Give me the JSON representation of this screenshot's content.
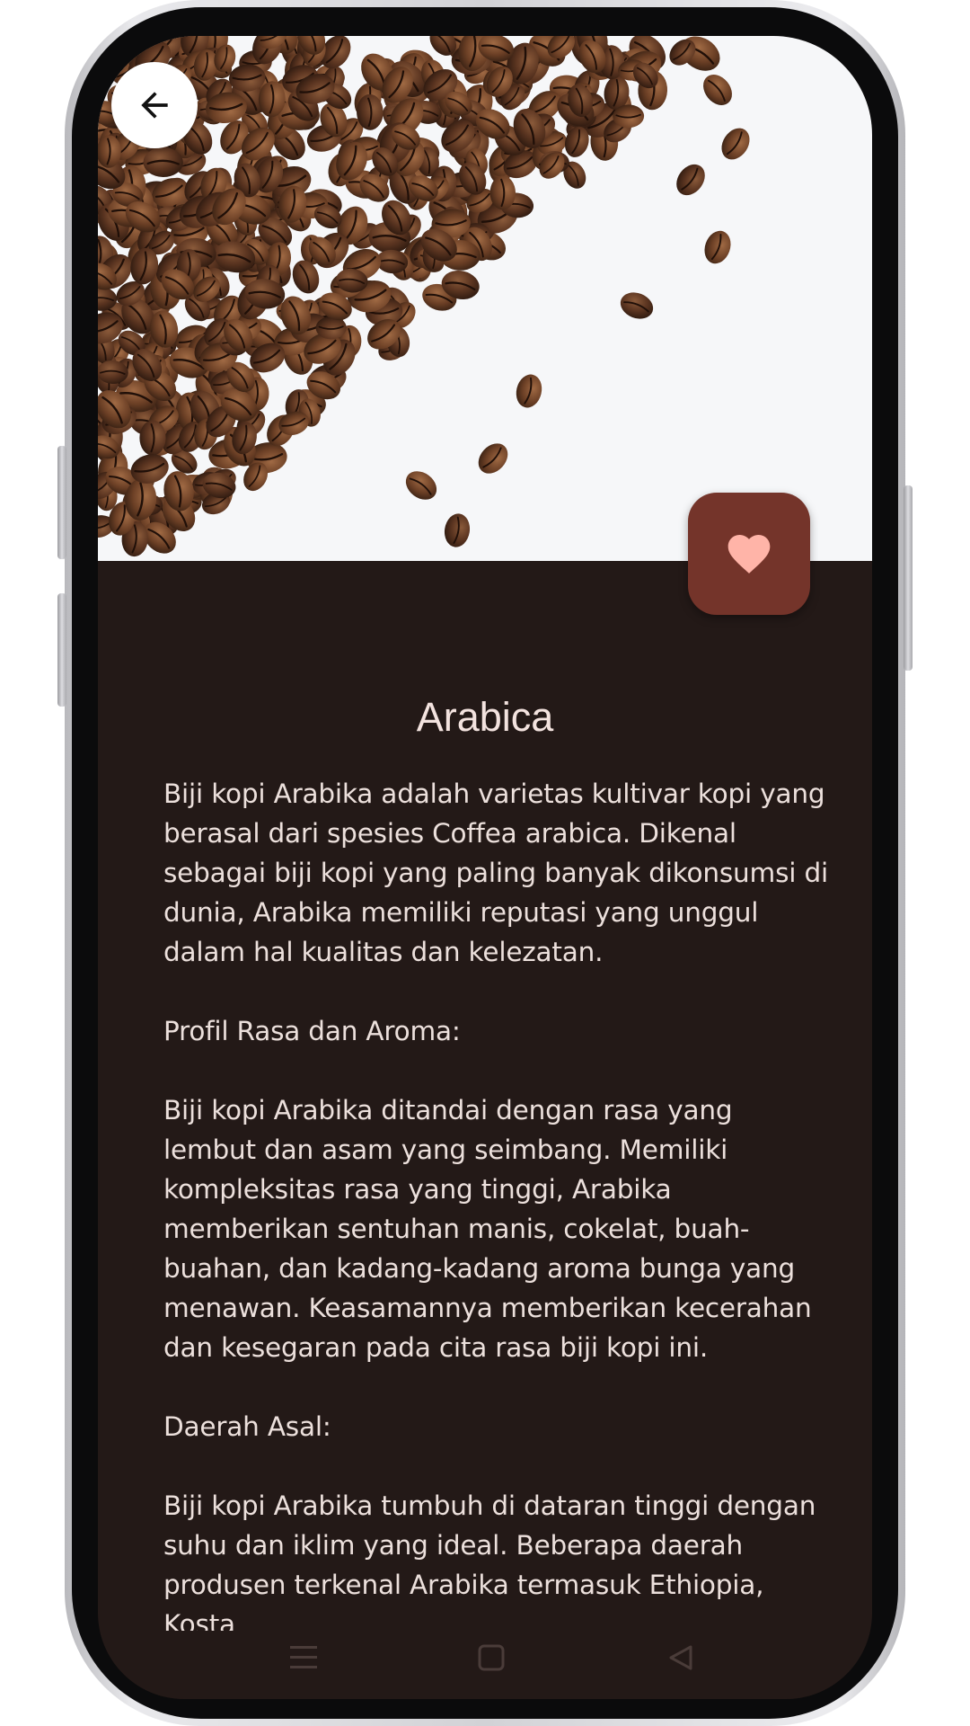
{
  "detail": {
    "title": "Arabica",
    "paragraphs": [
      "Biji kopi Arabika adalah varietas kultivar kopi yang berasal dari spesies Coffea arabica. Dikenal sebagai biji kopi yang paling banyak dikonsumsi di dunia, Arabika memiliki reputasi yang unggul dalam hal kualitas dan kelezatan.",
      "Profil Rasa dan Aroma:",
      "Biji kopi Arabika ditandai dengan rasa yang lembut dan asam yang seimbang. Memiliki kompleksitas rasa yang tinggi, Arabika memberikan sentuhan manis, cokelat, buah-buahan, dan kadang-kadang aroma bunga yang menawan. Keasamannya memberikan kecerahan dan kesegaran pada cita rasa biji kopi ini.",
      "Daerah Asal:",
      "Biji kopi Arabika tumbuh di dataran tinggi dengan suhu dan iklim yang ideal. Beberapa daerah produsen terkenal Arabika termasuk Ethiopia, Kosta"
    ]
  },
  "icons": {
    "back": "arrow-left-icon",
    "favorite": "heart-icon",
    "nav_menu": "menu-icon",
    "nav_home": "square-icon",
    "nav_back": "triangle-back-icon"
  },
  "colors": {
    "background": "#231917",
    "favorite_button": "#74342a",
    "favorite_heart": "#ffb4a8",
    "text": "#ece0dc"
  }
}
